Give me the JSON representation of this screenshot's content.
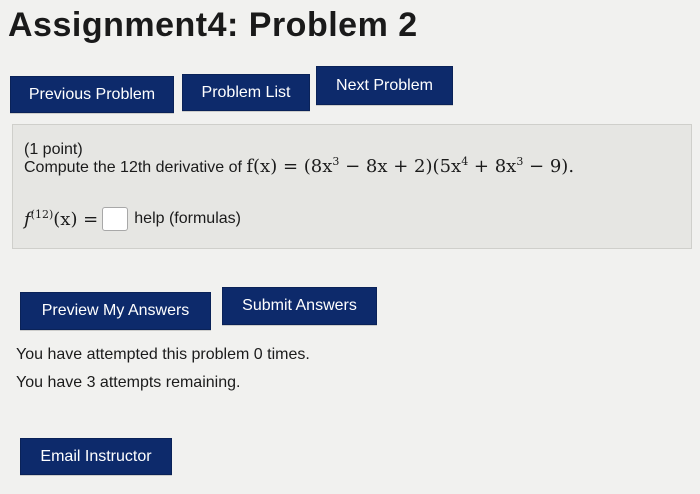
{
  "page": {
    "title": "Assignment4: Problem 2"
  },
  "nav": {
    "previous": "Previous Problem",
    "list": "Problem List",
    "next": "Next Problem"
  },
  "problem": {
    "points": "(1 point)",
    "prompt_prefix": "Compute the 12th derivative of",
    "function_lhs": "f(x) =",
    "factor1": {
      "open": "(8x",
      "exp1": "3",
      "rest": " − 8x + 2)"
    },
    "factor2": {
      "open": "(5x",
      "exp1": "4",
      "mid": " + 8x",
      "exp2": "3",
      "rest": " − 9)"
    },
    "period": ".",
    "answer_label_base": "f",
    "answer_label_exp": "(12)",
    "answer_label_rest": "(x) =",
    "answer_value": "",
    "help_link": "help (formulas)"
  },
  "actions": {
    "preview": "Preview My Answers",
    "submit": "Submit Answers"
  },
  "status": {
    "attempted": "You have attempted this problem 0 times.",
    "remaining": "You have 3 attempts remaining."
  },
  "footer": {
    "email": "Email Instructor"
  }
}
